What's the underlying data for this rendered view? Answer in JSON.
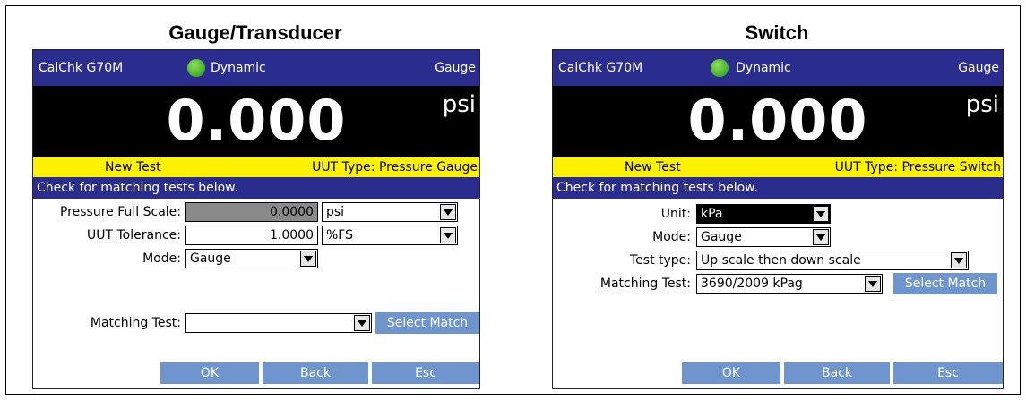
{
  "left_panel": {
    "heading": "Gauge/Transducer",
    "device": "CalChk G70M",
    "status": "Dynamic",
    "mode_indicator": "Gauge",
    "reading": "0.000",
    "unit": "psi",
    "new_test": "New Test",
    "uut_type": "UUT Type:  Pressure Gauge",
    "info": "Check for matching tests below.",
    "pressure_full_scale_label": "Pressure Full Scale:",
    "pressure_full_scale_value": "0.0000",
    "pressure_unit": "psi",
    "uut_tolerance_label": "UUT Tolerance:",
    "uut_tolerance_value": "1.0000",
    "tolerance_unit": "%FS",
    "mode_label": "Mode:",
    "mode_value": "Gauge",
    "matching_test_label": "Matching Test:",
    "matching_test_value": "",
    "select_match": "Select Match",
    "ok": "OK",
    "back": "Back",
    "esc": "Esc"
  },
  "right_panel": {
    "heading": "Switch",
    "device": "CalChk G70M",
    "status": "Dynamic",
    "mode_indicator": "Gauge",
    "reading": "0.000",
    "unit": "psi",
    "new_test": "New Test",
    "uut_type": "UUT Type:  Pressure Switch",
    "info": "Check for matching tests below.",
    "unit_label": "Unit:",
    "unit_value": "kPa",
    "mode_label": "Mode:",
    "mode_value": "Gauge",
    "test_type_label": "Test type:",
    "test_type_value": "Up scale then down scale",
    "matching_test_label": "Matching Test:",
    "matching_test_value": "3690/2009 kPag",
    "select_match": "Select Match",
    "ok": "OK",
    "back": "Back",
    "esc": "Esc"
  },
  "colors": {
    "title_bar": "#2b2d8e",
    "status_dot": "#4cb82e",
    "yellow_bar": "#fff200",
    "button": "#6f95cf"
  },
  "icons": [
    "status-dot-icon",
    "dropdown-arrow-icon"
  ]
}
